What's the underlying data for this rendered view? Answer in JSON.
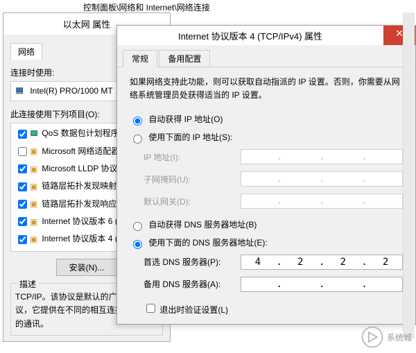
{
  "breadcrumb": "控制面板\\网络和 Internet\\网络连接",
  "eth": {
    "title": "以太网 属性",
    "tab_network": "网络",
    "label_connect_using": "连接时使用:",
    "adapter_name": "Intel(R) PRO/1000 MT",
    "label_items": "此连接使用下列项目(O):",
    "items": [
      {
        "checked": true,
        "icon": "planner",
        "label": "QoS 数据包计划程序"
      },
      {
        "checked": false,
        "icon": "proto",
        "label": "Microsoft 网络适配器"
      },
      {
        "checked": true,
        "icon": "proto",
        "label": "Microsoft LLDP 协议"
      },
      {
        "checked": true,
        "icon": "proto",
        "label": "链路层拓扑发现映射器"
      },
      {
        "checked": true,
        "icon": "proto",
        "label": "链路层拓扑发现响应程序"
      },
      {
        "checked": true,
        "icon": "proto",
        "label": "Internet 协议版本 6 ("
      },
      {
        "checked": true,
        "icon": "proto",
        "label": "Internet 协议版本 4 ("
      }
    ],
    "install_btn": "安装(N)...",
    "desc_title": "描述",
    "desc_text": "TCP/IP。该协议是默认的广域网络协议，它提供在不同的相互连接的网络上的通讯。"
  },
  "ipv4": {
    "title": "Internet 协议版本 4 (TCP/IPv4) 属性",
    "tab_general": "常规",
    "tab_alt": "备用配置",
    "description": "如果网络支持此功能，则可以获取自动指派的 IP 设置。否则，你需要从网络系统管理员处获得适当的 IP 设置。",
    "radio_ip_auto": "自动获得 IP 地址(O)",
    "radio_ip_manual": "使用下面的 IP 地址(S):",
    "ip_label": "IP 地址(I):",
    "mask_label": "子网掩码(U):",
    "gw_label": "默认网关(D):",
    "radio_dns_auto": "自动获得 DNS 服务器地址(B)",
    "radio_dns_manual": "使用下面的 DNS 服务器地址(E):",
    "dns1_label": "首选 DNS 服务器(P):",
    "dns2_label": "备用 DNS 服务器(A):",
    "dns1": {
      "o1": "4",
      "o2": "2",
      "o3": "2",
      "o4": "2"
    },
    "validate_label": "退出时验证设置(L)"
  },
  "watermark": "系统城"
}
